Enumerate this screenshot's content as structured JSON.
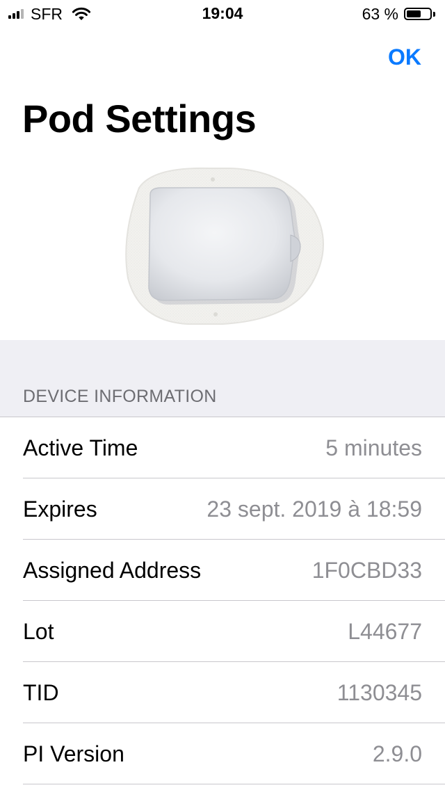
{
  "status_bar": {
    "carrier": "SFR",
    "time": "19:04",
    "battery_percent": "63 %",
    "battery_level": 0.63,
    "signal_bars": 3,
    "signal_max": 4
  },
  "nav": {
    "ok_label": "OK"
  },
  "page": {
    "title": "Pod Settings"
  },
  "section": {
    "header": "DEVICE INFORMATION"
  },
  "rows": [
    {
      "label": "Active Time",
      "value": "5 minutes"
    },
    {
      "label": "Expires",
      "value": "23 sept. 2019 à 18:59"
    },
    {
      "label": "Assigned Address",
      "value": "1F0CBD33"
    },
    {
      "label": "Lot",
      "value": "L44677"
    },
    {
      "label": "TID",
      "value": "1130345"
    },
    {
      "label": "PI Version",
      "value": "2.9.0"
    }
  ],
  "colors": {
    "accent": "#0a7aff",
    "grouped_background": "#efeff4",
    "secondary_text": "#8e8e93",
    "section_header_text": "#6d6d72",
    "separator": "#c8c7cc"
  }
}
